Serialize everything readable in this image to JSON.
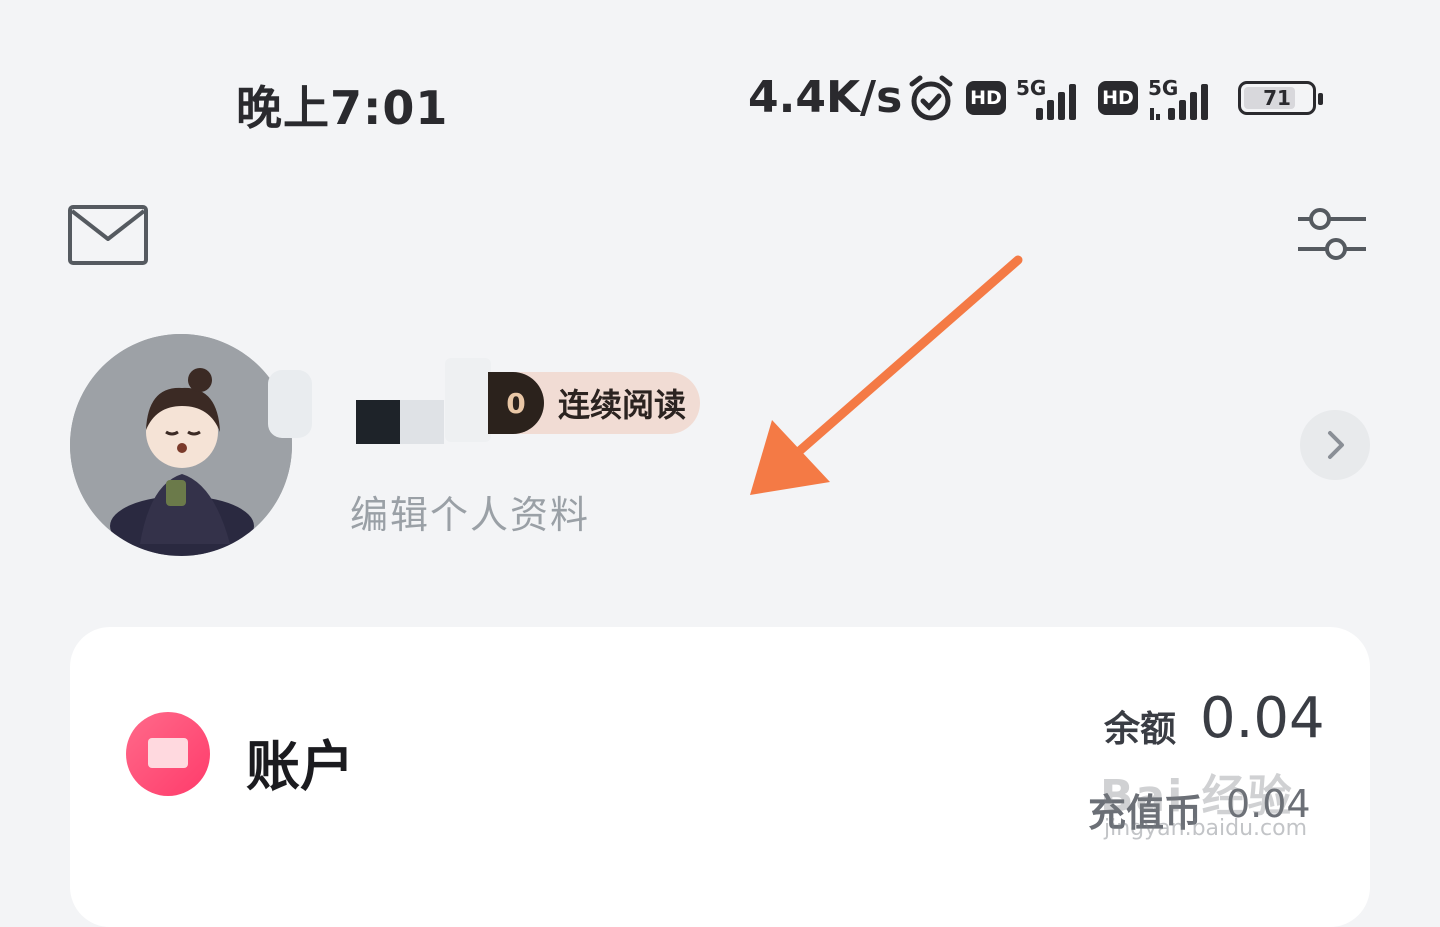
{
  "status_bar": {
    "time": "晚上7:01",
    "network_speed": "4.4K/s",
    "hd_label_1": "HD",
    "hd_label_2": "HD",
    "network_type_1": "5G",
    "network_type_2": "5G",
    "battery_level": "71",
    "icons": [
      "alarm-clock-icon",
      "hd-icon",
      "signal-icon",
      "hd-icon",
      "signal-icon",
      "battery-icon"
    ]
  },
  "header": {
    "icons": [
      "mail-icon",
      "settings-sliders-icon"
    ]
  },
  "profile": {
    "badge_count": "0",
    "badge_label": "连续阅读",
    "edit_label": "编辑个人资料",
    "chevron": "chevron-right-icon"
  },
  "account": {
    "title": "账户",
    "balance_label": "余额",
    "balance_value": "0.04",
    "coin_label": "充值币",
    "coin_value": "0.04"
  },
  "watermark": {
    "text": "Bai 经验",
    "url": "jingyan.baidu.com"
  },
  "colors": {
    "background": "#f3f4f6",
    "arrow": "#f47a45",
    "account_icon": "#ff4d74",
    "badge_pill": "#f1dcd4"
  }
}
